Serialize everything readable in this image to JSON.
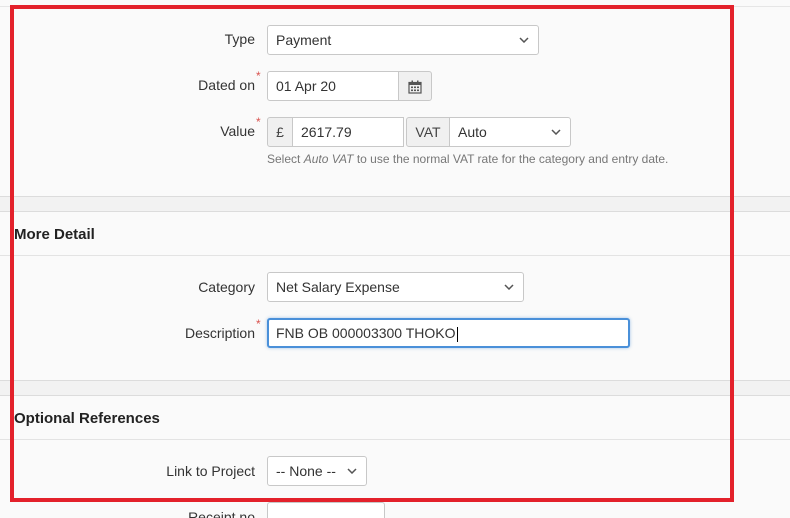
{
  "entry": {
    "type": {
      "label": "Type",
      "value": "Payment"
    },
    "dated_on": {
      "label": "Dated on",
      "required": "*",
      "value": "01 Apr 20"
    },
    "value": {
      "label": "Value",
      "required": "*",
      "currency_symbol": "£",
      "amount": "2617.79",
      "vat_label": "VAT",
      "vat_value": "Auto",
      "help_prefix": "Select ",
      "help_em": "Auto VAT",
      "help_suffix": " to use the normal VAT rate for the category and entry date."
    }
  },
  "more_detail": {
    "heading": "More Detail",
    "category": {
      "label": "Category",
      "value": "Net Salary Expense"
    },
    "description": {
      "label": "Description",
      "required": "*",
      "value": "FNB OB 000003300 THOKO"
    }
  },
  "optional_references": {
    "heading": "Optional References",
    "link_to_project": {
      "label": "Link to Project",
      "value": "-- None --"
    },
    "receipt_no": {
      "label": "Receipt no",
      "value": ""
    }
  },
  "colors": {
    "highlight_frame": "#e3212b",
    "focus_border": "#4a90d9",
    "required_marker": "#d9534f"
  },
  "icons": {
    "calendar": "calendar-icon",
    "dropdown": "chevron-down-icon"
  }
}
